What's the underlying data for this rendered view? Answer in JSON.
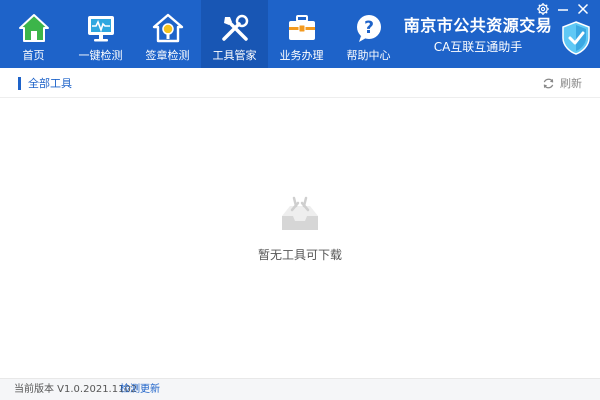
{
  "nav": {
    "items": [
      {
        "label": "首页",
        "icon": "home-icon"
      },
      {
        "label": "一键检测",
        "icon": "monitor-check-icon"
      },
      {
        "label": "签章检测",
        "icon": "seal-house-icon"
      },
      {
        "label": "工具管家",
        "icon": "tools-icon"
      },
      {
        "label": "业务办理",
        "icon": "briefcase-icon"
      },
      {
        "label": "帮助中心",
        "icon": "help-icon"
      }
    ],
    "active_index": 3
  },
  "brand": {
    "title": "南京市公共资源交易",
    "subtitle": "CA互联互通助手",
    "logo_icon": "shield-check-icon"
  },
  "window_controls": {
    "settings_icon": "gear-icon",
    "minimize_icon": "minimize-icon",
    "close_icon": "close-icon"
  },
  "section": {
    "title": "全部工具",
    "refresh_label": "刷新"
  },
  "empty_state": {
    "icon": "empty-box-icon",
    "message": "暂无工具可下载"
  },
  "footer": {
    "version_text": "当前版本 V1.0.2021.1102",
    "update_link": "检测更新"
  },
  "colors": {
    "header_bg": "#1e63c9",
    "active_tab_bg": "#1856b4",
    "accent": "#1e63c9",
    "footer_bg": "#f5f6f8"
  }
}
